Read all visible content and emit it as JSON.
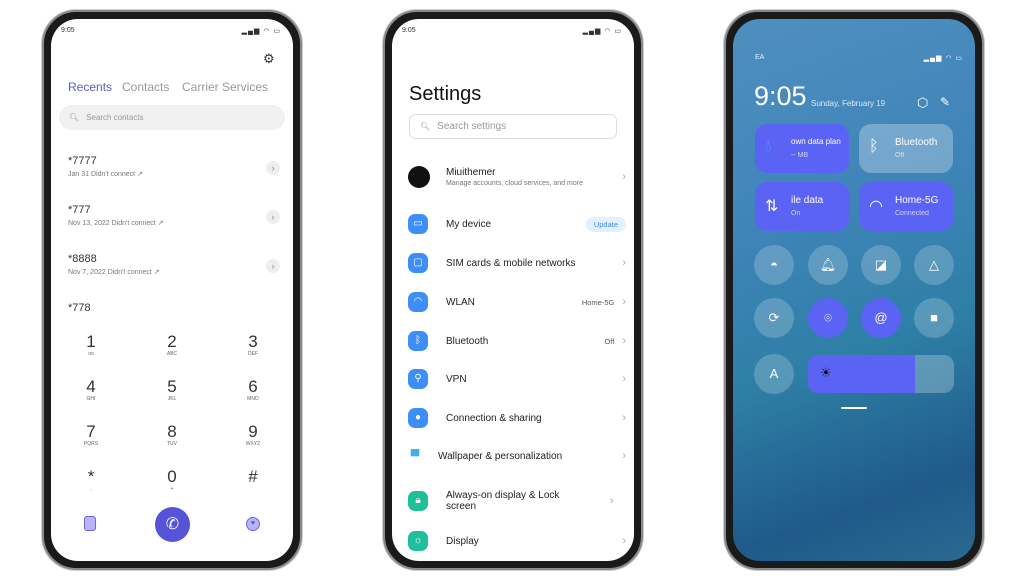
{
  "dialer": {
    "status_time": "9:05",
    "status_icons": "signal wifi battery",
    "settings_icon": "gear-icon",
    "tabs": [
      {
        "label": "Recents",
        "active": true
      },
      {
        "label": "Contacts",
        "active": false
      },
      {
        "label": "Carrier Services",
        "active": false
      }
    ],
    "search_placeholder": "Search contacts",
    "recents": [
      {
        "number": "*7777",
        "detail": "Jan 31 Didn't connect"
      },
      {
        "number": "*777",
        "detail": "Nov 13, 2022 Didn't connect"
      },
      {
        "number": "*8888",
        "detail": "Nov 7, 2022 Didn't connect"
      },
      {
        "number": "*778",
        "detail": ""
      }
    ],
    "keys": [
      {
        "d": "1",
        "l": "ᴏᴏ"
      },
      {
        "d": "2",
        "l": "ABC"
      },
      {
        "d": "3",
        "l": "DEF"
      },
      {
        "d": "4",
        "l": "GHI"
      },
      {
        "d": "5",
        "l": "JKL"
      },
      {
        "d": "6",
        "l": "MNO"
      },
      {
        "d": "7",
        "l": "PQRS"
      },
      {
        "d": "8",
        "l": "TUV"
      },
      {
        "d": "9",
        "l": "WXYZ"
      },
      {
        "d": "*",
        "l": ","
      },
      {
        "d": "0",
        "l": "+"
      },
      {
        "d": "#",
        "l": ""
      }
    ],
    "accent": "#5553d6"
  },
  "settings": {
    "status_time": "9:05",
    "title": "Settings",
    "search_placeholder": "Search settings",
    "account": {
      "name": "Miuithemer",
      "desc": "Manage accounts, cloud services, and more"
    },
    "items": [
      {
        "label": "My device",
        "badge": "Update"
      },
      {
        "label": "SIM cards & mobile networks"
      },
      {
        "label": "WLAN",
        "value": "Home-5G"
      },
      {
        "label": "Bluetooth",
        "value": "Off"
      },
      {
        "label": "VPN"
      },
      {
        "label": "Connection & sharing"
      },
      {
        "label": "Wallpaper & personalization"
      },
      {
        "label": "Always-on display & Lock screen"
      },
      {
        "label": "Display"
      }
    ]
  },
  "control_center": {
    "carrier": "EA",
    "time": "9:05",
    "date": "Sunday, February 19",
    "tiles": [
      {
        "title": "own data plan",
        "sub": "-- MB"
      },
      {
        "title": "Bluetooth",
        "sub": "Off"
      },
      {
        "title": "ile data",
        "sub": "On"
      },
      {
        "title": "Home-5G",
        "sub": "Connected"
      }
    ],
    "brightness_percent": 73,
    "auto_brightness_label": "A"
  }
}
